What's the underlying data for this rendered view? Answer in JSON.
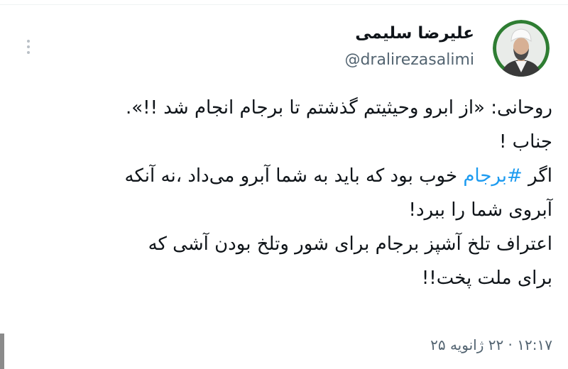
{
  "author": {
    "display_name": "علیرضا سلیمی",
    "handle": "@dralirezasalimi",
    "avatar_icon": "profile-photo-cleric"
  },
  "tweet": {
    "line1": "روحانی: «از ابرو وحیثیتم گذشتم تا برجام انجام شد !!».",
    "line2": "جناب !",
    "line3_before": "اگر ",
    "hashtag": "#برجام",
    "line3_after": " خوب بود که باید به شما آبرو می‌داد ،نه آنکه",
    "line4": "آبروی شما را ببرد!",
    "line5": "اعتراف تلخ آشپز  برجام برای شور وتلخ بودن آشی که",
    "line6": "برای ملت پخت!!"
  },
  "meta": {
    "timestamp": "۱۲:۱۷ · ۲۲ ژانویه ۲۵"
  },
  "colors": {
    "text": "#0f1419",
    "secondary": "#536471",
    "link": "#1d9bf0",
    "avatar_ring": "#2e7d32"
  },
  "icons": {
    "more": "more-vertical-icon"
  }
}
